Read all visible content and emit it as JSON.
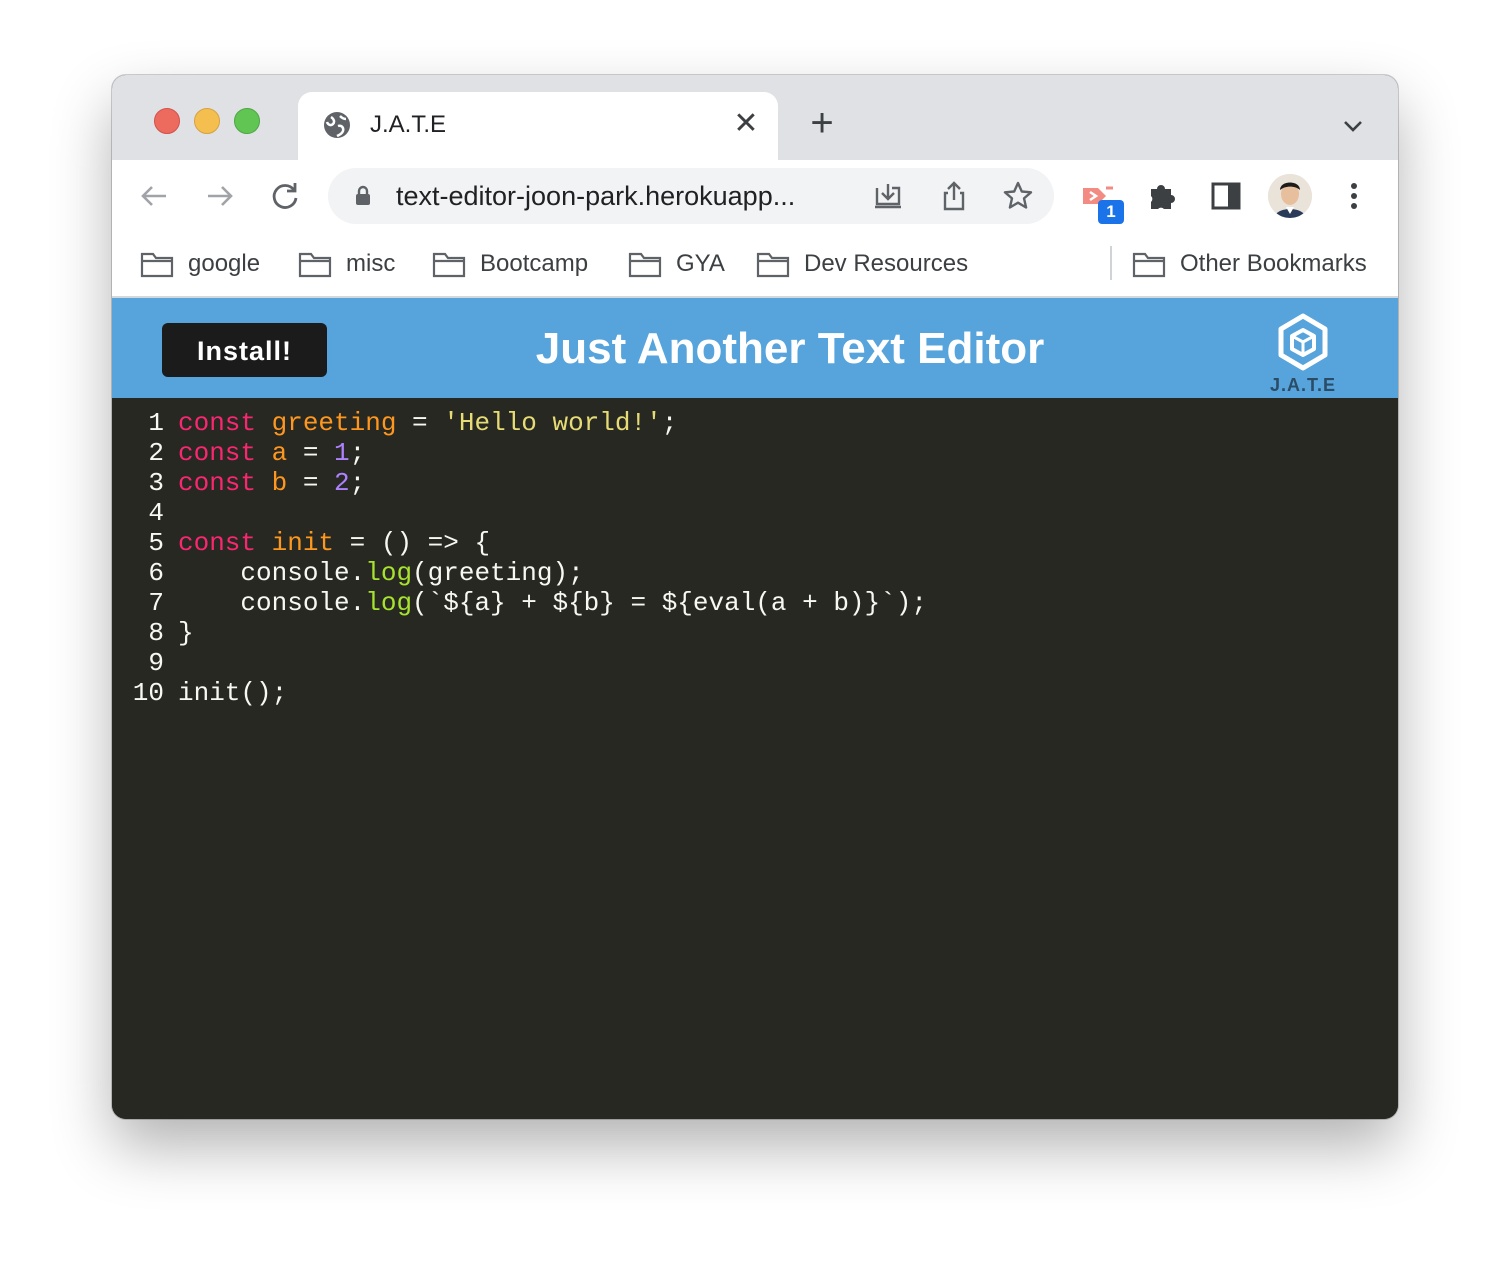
{
  "browser": {
    "tab_title": "J.A.T.E",
    "url": "text-editor-joon-park.herokuapp...",
    "extension_badge": "1",
    "bookmarks": [
      "google",
      "misc",
      "Bootcamp",
      "GYA",
      "Dev Resources"
    ],
    "other_bookmarks": "Other Bookmarks"
  },
  "app": {
    "install_label": "Install!",
    "title": "Just Another Text Editor",
    "logo_text": "J.A.T.E"
  },
  "editor": {
    "line_numbers": [
      "1",
      "2",
      "3",
      "4",
      "5",
      "6",
      "7",
      "8",
      "9",
      "10"
    ],
    "lines": [
      [
        {
          "t": "kw",
          "v": "const"
        },
        {
          "t": "p",
          "v": " "
        },
        {
          "t": "def",
          "v": "greeting"
        },
        {
          "t": "p",
          "v": " = "
        },
        {
          "t": "str",
          "v": "'Hello world!'"
        },
        {
          "t": "p",
          "v": ";"
        }
      ],
      [
        {
          "t": "kw",
          "v": "const"
        },
        {
          "t": "p",
          "v": " "
        },
        {
          "t": "def",
          "v": "a"
        },
        {
          "t": "p",
          "v": " = "
        },
        {
          "t": "num",
          "v": "1"
        },
        {
          "t": "p",
          "v": ";"
        }
      ],
      [
        {
          "t": "kw",
          "v": "const"
        },
        {
          "t": "p",
          "v": " "
        },
        {
          "t": "def",
          "v": "b"
        },
        {
          "t": "p",
          "v": " = "
        },
        {
          "t": "num",
          "v": "2"
        },
        {
          "t": "p",
          "v": ";"
        }
      ],
      [],
      [
        {
          "t": "kw",
          "v": "const"
        },
        {
          "t": "p",
          "v": " "
        },
        {
          "t": "def",
          "v": "init"
        },
        {
          "t": "p",
          "v": " = () => {"
        }
      ],
      [
        {
          "t": "p",
          "v": "    console."
        },
        {
          "t": "prop",
          "v": "log"
        },
        {
          "t": "p",
          "v": "(greeting);"
        }
      ],
      [
        {
          "t": "p",
          "v": "    console."
        },
        {
          "t": "prop",
          "v": "log"
        },
        {
          "t": "p",
          "v": "(`${a} + ${b} = ${eval(a + b)}`);"
        }
      ],
      [
        {
          "t": "p",
          "v": "}"
        }
      ],
      [],
      [
        {
          "t": "p",
          "v": "init();"
        }
      ]
    ]
  },
  "colors": {
    "header_bg": "#56a4db",
    "editor_bg": "#272822",
    "keyword": "#f92672",
    "definition": "#fd971f",
    "string": "#e6db74",
    "number": "#ae81ff",
    "property": "#a6e22e"
  },
  "icons": [
    "globe-icon",
    "close-icon",
    "plus-icon",
    "chevron-down-icon",
    "back-arrow-icon",
    "forward-arrow-icon",
    "reload-icon",
    "lock-icon",
    "install-app-icon",
    "share-icon",
    "star-icon",
    "extension-icon",
    "puzzle-icon",
    "side-panel-icon",
    "avatar",
    "more-vert-icon",
    "folder-icon",
    "jate-logo-icon"
  ]
}
